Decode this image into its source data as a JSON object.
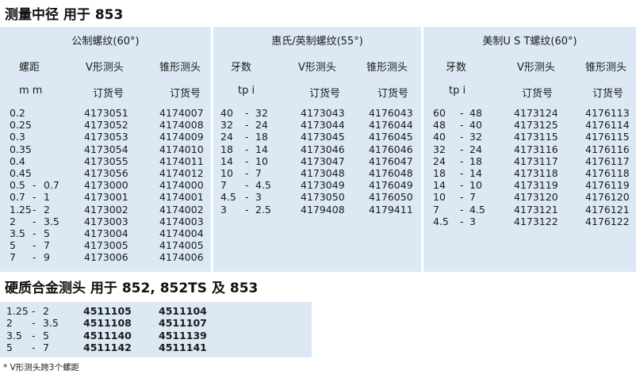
{
  "title_main": "测量中径 用于 853",
  "title_carbide": "硬质合金测头 用于 852, 852TS 及 853",
  "footnote": "* V形测头跨3个螺距",
  "metric": {
    "heading": "公制螺纹(60°)",
    "col1": [
      "螺距",
      "m m"
    ],
    "col2": [
      "V形测头",
      "订货号"
    ],
    "col3": [
      "锥形测头",
      "订货号"
    ],
    "rows": [
      [
        "0.2",
        "",
        "",
        "4173051",
        "4174007"
      ],
      [
        "0.25",
        "",
        "",
        "4173052",
        "4174008"
      ],
      [
        "0.3",
        "",
        "",
        "4173053",
        "4174009"
      ],
      [
        "0.35",
        "",
        "",
        "4173054",
        "4174010"
      ],
      [
        "0.4",
        "",
        "",
        "4173055",
        "4174011"
      ],
      [
        "0.45",
        "",
        "",
        "4173056",
        "4174012"
      ],
      [
        "0.5",
        "-",
        "0.7",
        "4173000",
        "4174000"
      ],
      [
        "0.7",
        "-",
        "1",
        "4173001",
        "4174001"
      ],
      [
        "1.25",
        "-",
        "2",
        "4173002",
        "4174002"
      ],
      [
        "2",
        "-",
        "3.5",
        "4173003",
        "4174003"
      ],
      [
        "3.5",
        "-",
        "5",
        "4173004",
        "4174004"
      ],
      [
        "5",
        "-",
        "7",
        "4173005",
        "4174005"
      ],
      [
        "7",
        "-",
        "9",
        "4173006",
        "4174006"
      ]
    ]
  },
  "whitworth": {
    "heading": "惠氏/英制螺纹(55°)",
    "col1": [
      "牙数",
      "tp i"
    ],
    "col2": [
      "V形测头",
      "订货号"
    ],
    "col3": [
      "锥形测头",
      "订货号"
    ],
    "rows": [
      [
        "40",
        "-",
        "32",
        "4173043",
        "4176043"
      ],
      [
        "32",
        "-",
        "24",
        "4173044",
        "4176044"
      ],
      [
        "24",
        "-",
        "18",
        "4173045",
        "4176045"
      ],
      [
        "18",
        "-",
        "14",
        "4173046",
        "4176046"
      ],
      [
        "14",
        "-",
        "10",
        "4173047",
        "4176047"
      ],
      [
        "10",
        "-",
        "7",
        "4173048",
        "4176048"
      ],
      [
        "7",
        "-",
        "4.5",
        "4173049",
        "4176049"
      ],
      [
        "4.5",
        "-",
        "3",
        "4173050",
        "4176050"
      ],
      [
        "3",
        "-",
        "2.5",
        "4179408",
        "4179411"
      ]
    ]
  },
  "ust": {
    "heading": "美制U S T螺纹(60°)",
    "col1": [
      "牙数",
      "tp i"
    ],
    "col2": [
      "V形测头",
      "订货号"
    ],
    "col3": [
      "锥形测头",
      "订货号"
    ],
    "rows": [
      [
        "60",
        "-",
        "48",
        "4173124",
        "4176113"
      ],
      [
        "48",
        "-",
        "40",
        "4173125",
        "4176114"
      ],
      [
        "40",
        "-",
        "32",
        "4173115",
        "4176115"
      ],
      [
        "32",
        "-",
        "24",
        "4173116",
        "4176116"
      ],
      [
        "24",
        "-",
        "18",
        "4173117",
        "4176117"
      ],
      [
        "18",
        "-",
        "14",
        "4173118",
        "4176118"
      ],
      [
        "14",
        "-",
        "10",
        "4173119",
        "4176119"
      ],
      [
        "10",
        "-",
        "7",
        "4173120",
        "4176120"
      ],
      [
        "7",
        "-",
        "4.5",
        "4173121",
        "4176121"
      ],
      [
        "4.5",
        "-",
        "3",
        "4173122",
        "4176122"
      ]
    ]
  },
  "carbide": {
    "rows": [
      [
        "1.25",
        "-",
        "2",
        "4511105",
        "4511104"
      ],
      [
        "2",
        "-",
        "3.5",
        "4511108",
        "4511107"
      ],
      [
        "3.5",
        "-",
        "5",
        "4511140",
        "4511139"
      ],
      [
        "5",
        "-",
        "7",
        "4511142",
        "4511141"
      ]
    ]
  }
}
